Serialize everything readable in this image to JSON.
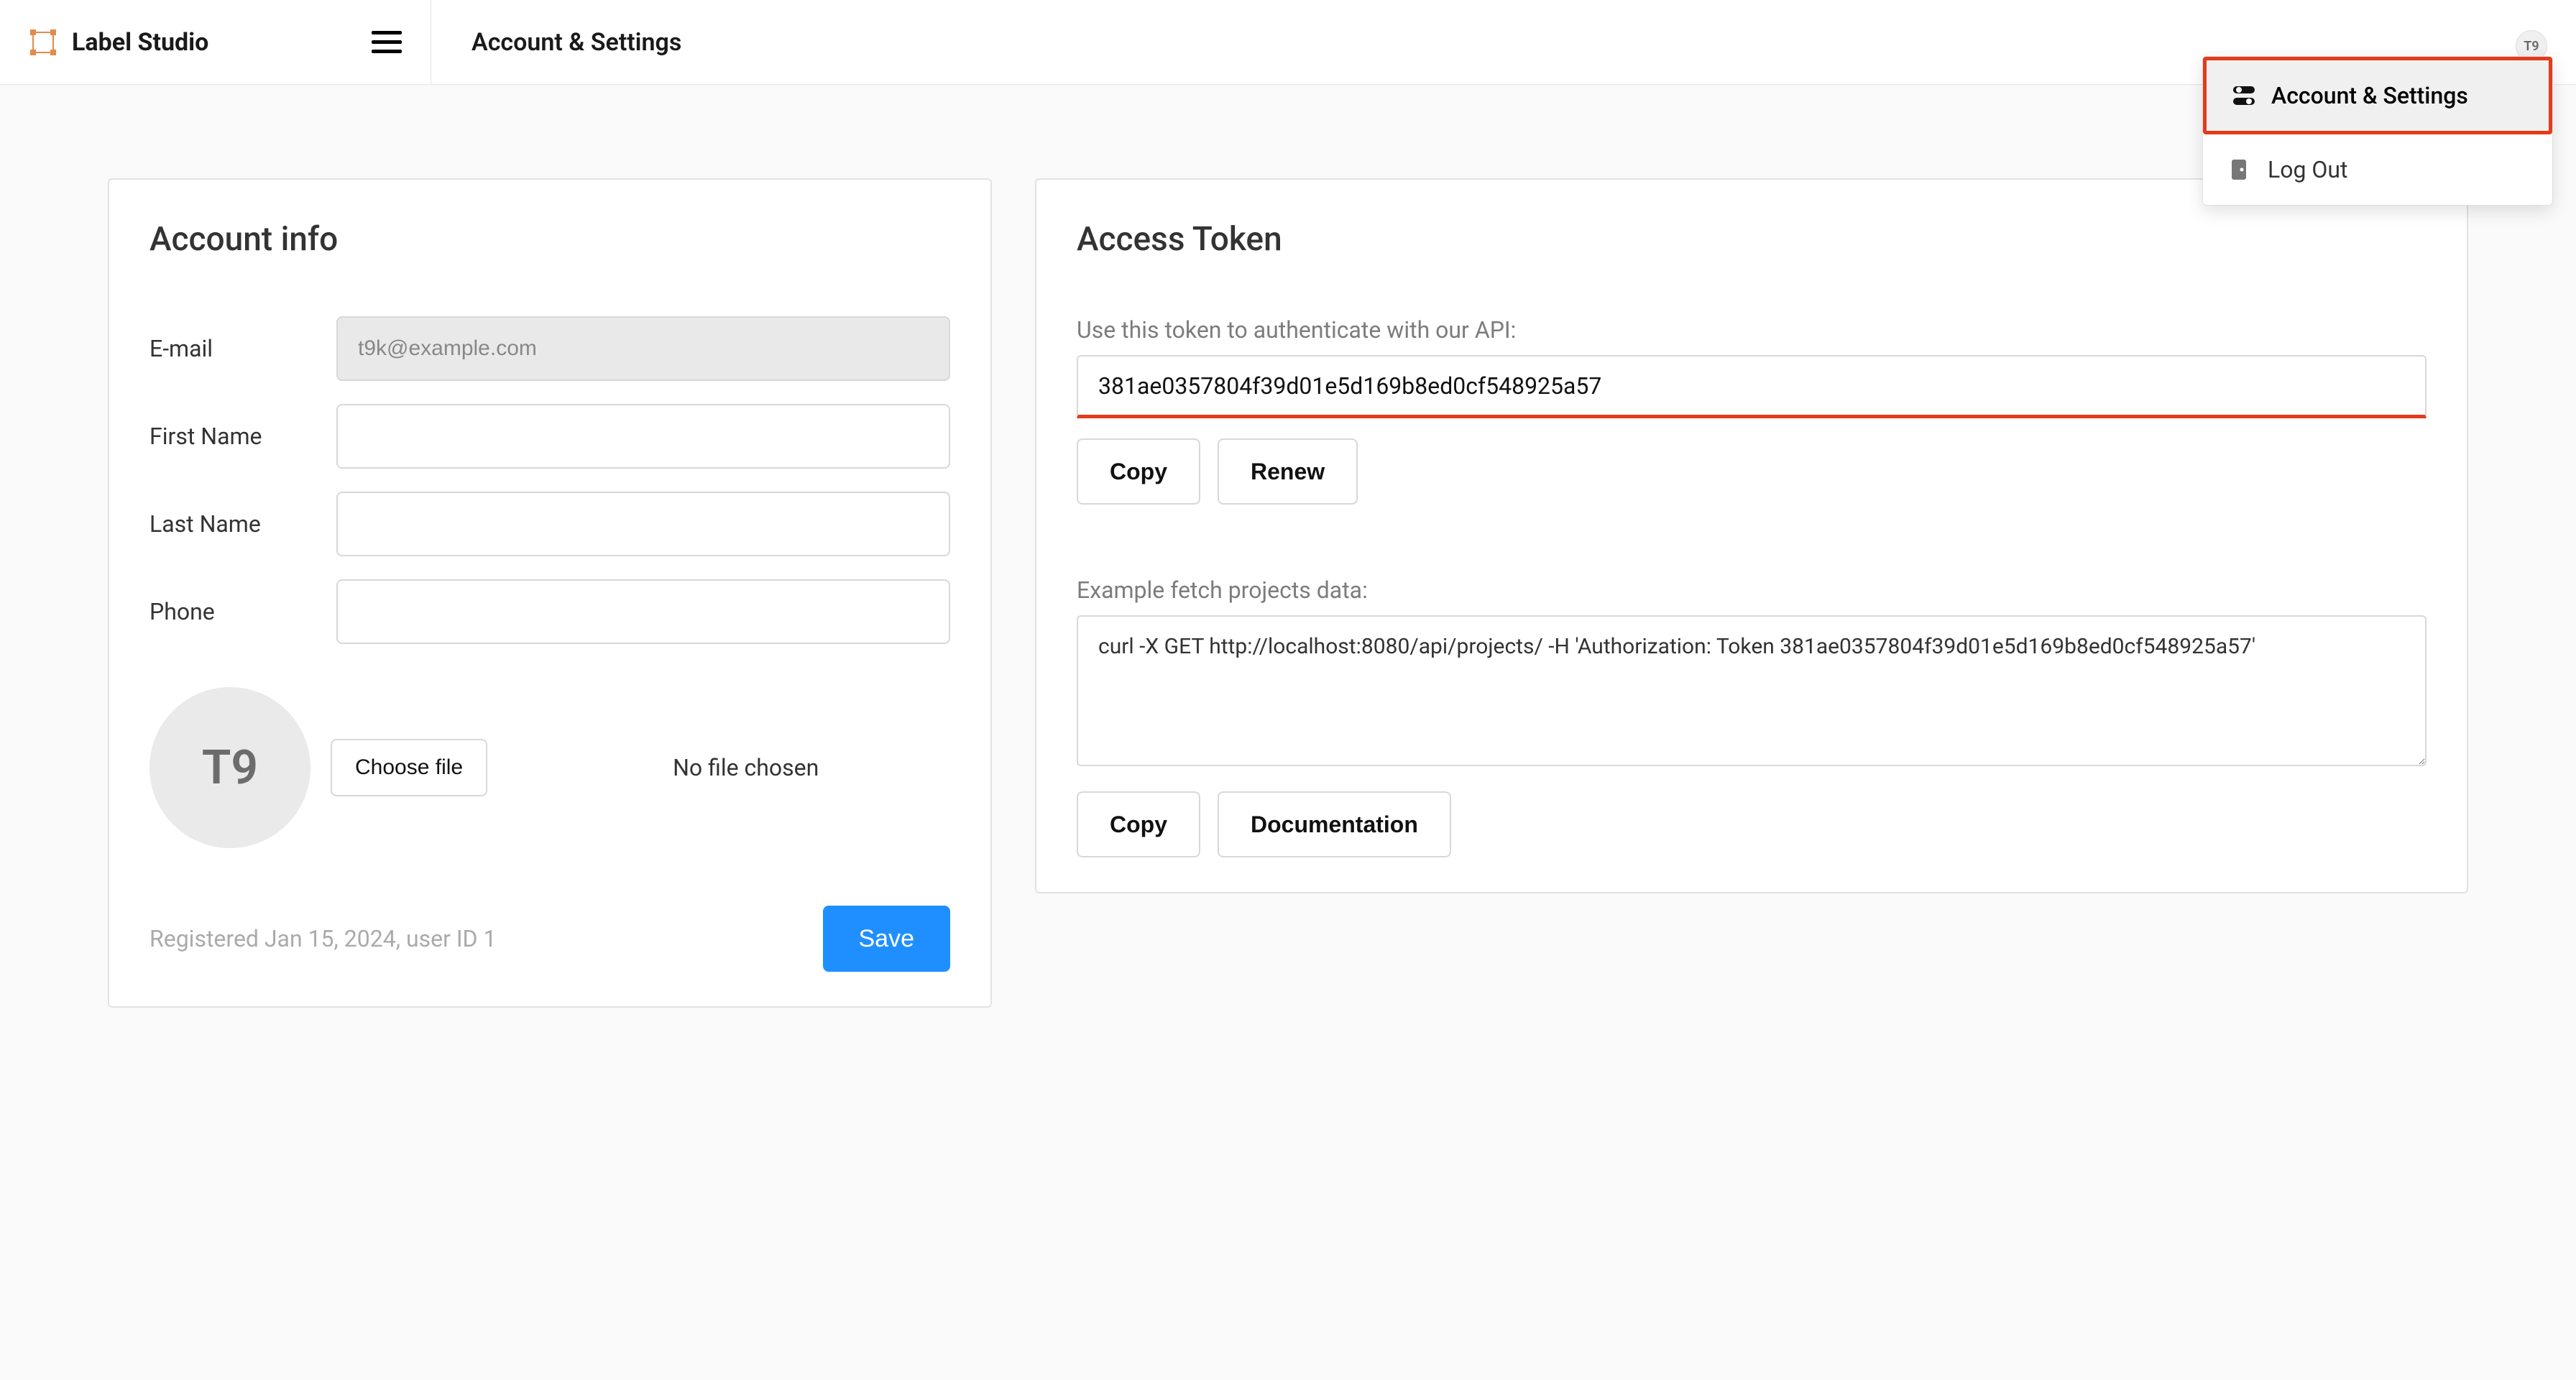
{
  "header": {
    "app_name": "Label Studio",
    "page_title": "Account & Settings",
    "avatar_initials": "T9"
  },
  "dropdown": {
    "account_settings": "Account & Settings",
    "logout": "Log Out"
  },
  "account_info": {
    "title": "Account info",
    "labels": {
      "email": "E-mail",
      "first_name": "First Name",
      "last_name": "Last Name",
      "phone": "Phone"
    },
    "values": {
      "email": "t9k@example.com",
      "first_name": "",
      "last_name": "",
      "phone": ""
    },
    "avatar_initials": "T9",
    "choose_file_label": "Choose file",
    "file_status": "No file chosen",
    "registered_meta": "Registered Jan 15, 2024, user ID 1",
    "save_label": "Save"
  },
  "token": {
    "title": "Access Token",
    "description": "Use this token to authenticate with our API:",
    "token_value": "381ae0357804f39d01e5d169b8ed0cf548925a57",
    "copy_label": "Copy",
    "renew_label": "Renew",
    "example_label": "Example fetch projects data:",
    "example_value": "curl -X GET http://localhost:8080/api/projects/ -H 'Authorization: Token 381ae0357804f39d01e5d169b8ed0cf548925a57'",
    "documentation_label": "Documentation"
  }
}
